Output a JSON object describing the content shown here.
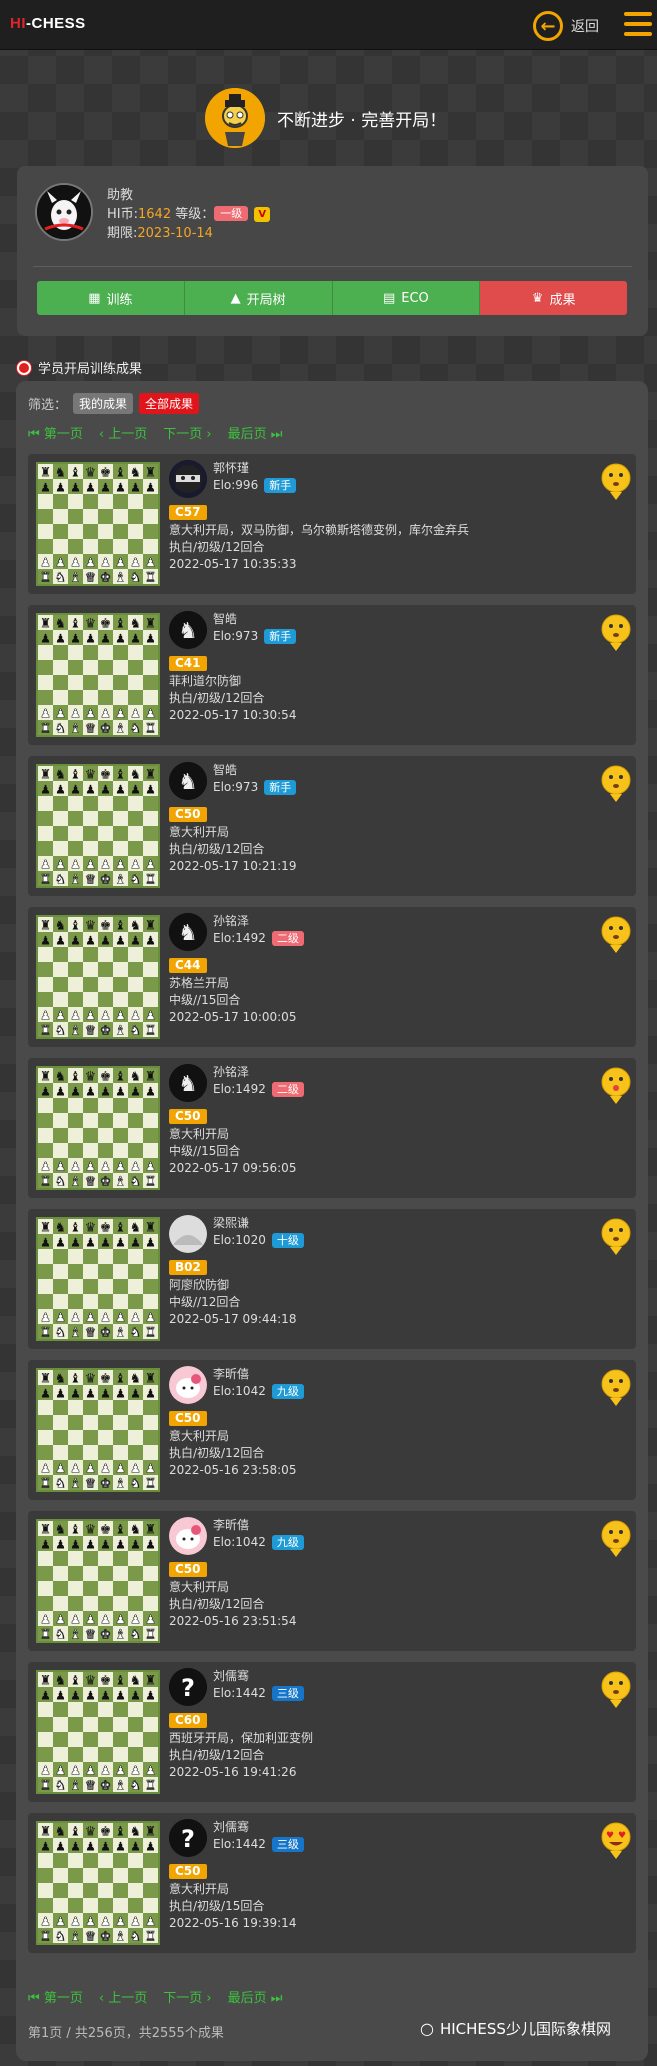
{
  "header": {
    "logo_hi": "HI",
    "logo_rest": "-CHESS",
    "back_label": "返回"
  },
  "slogan": "不断进步 · 完善开局！",
  "profile": {
    "name": "助教",
    "coin_label": "HI币:",
    "coins": "1642",
    "level_label": "等级：",
    "level": "一级",
    "vip": "V",
    "expire_label": "期限:",
    "expire": "2023-10-14"
  },
  "tabs": [
    {
      "label": "训练",
      "icon": "book-icon"
    },
    {
      "label": "开局树",
      "icon": "tree-icon"
    },
    {
      "label": "ECO",
      "icon": "list-icon"
    },
    {
      "label": "成果",
      "icon": "crown-icon"
    }
  ],
  "section_title": "学员开局训练成果",
  "filter": {
    "label": "筛选：",
    "options": [
      "我的成果",
      "全部成果"
    ],
    "active": "全部成果"
  },
  "pager": {
    "first": "第一页",
    "prev": "上一页",
    "next": "下一页",
    "last": "最后页"
  },
  "records": [
    {
      "name": "郭怀瑾",
      "elo": "Elo:996",
      "level": "新手",
      "level_color": "green",
      "eco": "C57",
      "desc": "意大利开局，双马防御，乌尔赖斯塔德变例，库尔金弃兵",
      "mode": "执白/初级/12回合",
      "date": "2022-05-17 10:35:33",
      "avatar": "ninja",
      "emoji": "neutral"
    },
    {
      "name": "智皓",
      "elo": "Elo:973",
      "level": "新手",
      "level_color": "green",
      "eco": "C41",
      "desc": "菲利道尔防御",
      "mode": "执白/初级/12回合",
      "date": "2022-05-17 10:30:54",
      "avatar": "horse",
      "emoji": "neutral"
    },
    {
      "name": "智皓",
      "elo": "Elo:973",
      "level": "新手",
      "level_color": "green",
      "eco": "C50",
      "desc": "意大利开局",
      "mode": "执白/初级/12回合",
      "date": "2022-05-17 10:21:19",
      "avatar": "horse",
      "emoji": "neutral"
    },
    {
      "name": "孙铭泽",
      "elo": "Elo:1492",
      "level": "二级",
      "level_color": "red",
      "eco": "C44",
      "desc": "苏格兰开局",
      "mode": "中级//15回合",
      "date": "2022-05-17 10:00:05",
      "avatar": "horse",
      "emoji": "neutral"
    },
    {
      "name": "孙铭泽",
      "elo": "Elo:1492",
      "level": "二级",
      "level_color": "red",
      "eco": "C50",
      "desc": "意大利开局",
      "mode": "中级//15回合",
      "date": "2022-05-17 09:56:05",
      "avatar": "horse",
      "emoji": "tongue"
    },
    {
      "name": "梁熙谦",
      "elo": "Elo:1020",
      "level": "十级",
      "level_color": "green",
      "eco": "B02",
      "desc": "阿廖欣防御",
      "mode": "中级//12回合",
      "date": "2022-05-17 09:44:18",
      "avatar": "photo",
      "emoji": "neutral"
    },
    {
      "name": "李昕僖",
      "elo": "Elo:1042",
      "level": "九级",
      "level_color": "green",
      "eco": "C50",
      "desc": "意大利开局",
      "mode": "执白/初级/12回合",
      "date": "2022-05-16 23:58:05",
      "avatar": "kitty",
      "emoji": "neutral"
    },
    {
      "name": "李昕僖",
      "elo": "Elo:1042",
      "level": "九级",
      "level_color": "green",
      "eco": "C50",
      "desc": "意大利开局",
      "mode": "执白/初级/12回合",
      "date": "2022-05-16 23:51:54",
      "avatar": "kitty",
      "emoji": "neutral"
    },
    {
      "name": "刘儒骞",
      "elo": "Elo:1442",
      "level": "三级",
      "level_color": "blue",
      "eco": "C60",
      "desc": "西班牙开局，保加利亚变例",
      "mode": "执白/初级/12回合",
      "date": "2022-05-16 19:41:26",
      "avatar": "question",
      "emoji": "neutral"
    },
    {
      "name": "刘儒骞",
      "elo": "Elo:1442",
      "level": "三级",
      "level_color": "blue",
      "eco": "C50",
      "desc": "意大利开局",
      "mode": "执白/初级/15回合",
      "date": "2022-05-16 19:39:14",
      "avatar": "question",
      "emoji": "love"
    }
  ],
  "footer": "第1页 / 共256页，共2555个成果",
  "watermark": "HICHESS少儿国际象棋网",
  "colors": {
    "accent": "#f2a400",
    "green": "#4caf50",
    "red": "#e04b4b"
  }
}
